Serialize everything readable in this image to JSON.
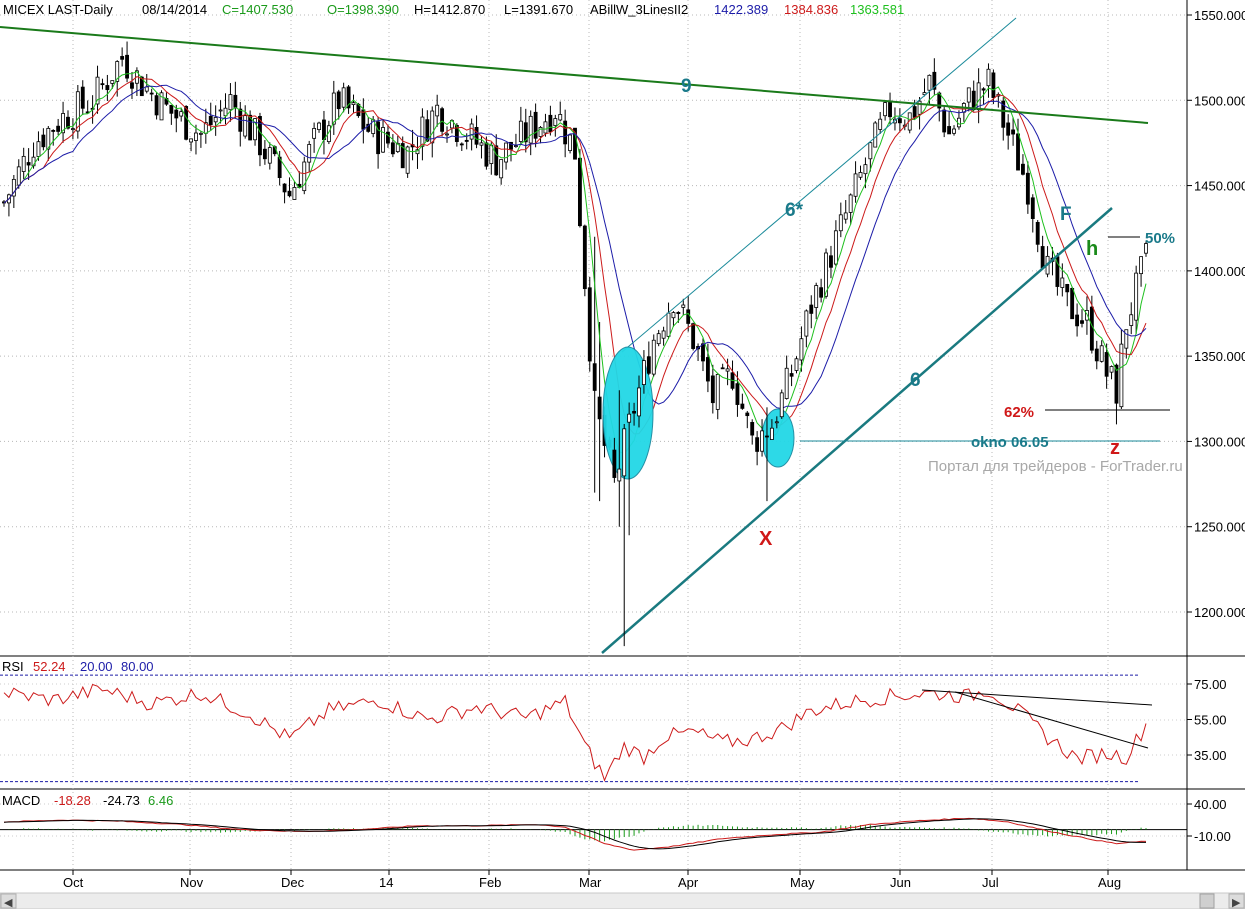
{
  "header": {
    "symbol": "MICEX LAST-Daily",
    "date": "08/14/2014",
    "close": "C=1407.530",
    "open": "O=1398.390",
    "high": "H=1412.870",
    "low": "L=1391.670",
    "indicator": "ABillW_3LinesII2",
    "ind_blue": "1422.389",
    "ind_red": "1384.836",
    "ind_green": "1363.581"
  },
  "watermark": "Портал для трейдеров - ForTrader.ru",
  "annotations": {
    "line9": "9",
    "line6star": "6*",
    "line6": "6",
    "X": "X",
    "F": "F",
    "h": "h",
    "z": "z",
    "pct50": "50%",
    "pct62": "62%",
    "okno": "okno 06.05"
  },
  "rsi": {
    "label": "RSI",
    "value": "52.24",
    "lower": "20.00",
    "upper": "80.00"
  },
  "macd": {
    "label": "MACD",
    "v1": "-18.28",
    "v2": "-24.73",
    "v3": "6.46"
  },
  "colors": {
    "up": "#000000",
    "down": "#000000",
    "ma_blue": "#1c1ca8",
    "ma_red": "#cc1a1a",
    "ma_green": "#1ec01e",
    "trend_green": "#1a7a1a",
    "channel": "#1a8a8a",
    "ellipse": "#22d8e6",
    "annot_red": "#d01818",
    "annot_teal": "#1a7a8a"
  },
  "chart_data": {
    "type": "candlestick",
    "price_axis": {
      "ticks": [
        "1550.000",
        "1500.000",
        "1450.000",
        "1400.000",
        "1350.000",
        "1300.000",
        "1250.000",
        "1200.000"
      ],
      "ylim": [
        1170,
        1560
      ]
    },
    "rsi_axis": {
      "ticks": [
        "75.00",
        "55.00",
        "35.00"
      ],
      "ylim": [
        15,
        95
      ]
    },
    "macd_axis": {
      "ticks": [
        "40.00",
        "-10.00"
      ],
      "ylim": [
        -40,
        55
      ]
    },
    "x_labels": [
      "Oct",
      "Nov",
      "Dec",
      "14",
      "Feb",
      "Mar",
      "Apr",
      "May",
      "Jun",
      "Jul",
      "Aug"
    ],
    "grid": true,
    "price_keyframes": [
      [
        0,
        1440
      ],
      [
        6,
        1475
      ],
      [
        12,
        1490
      ],
      [
        18,
        1500
      ],
      [
        24,
        1525
      ],
      [
        28,
        1510
      ],
      [
        33,
        1495
      ],
      [
        40,
        1480
      ],
      [
        46,
        1500
      ],
      [
        52,
        1475
      ],
      [
        58,
        1445
      ],
      [
        63,
        1475
      ],
      [
        68,
        1500
      ],
      [
        75,
        1480
      ],
      [
        82,
        1470
      ],
      [
        88,
        1495
      ],
      [
        94,
        1480
      ],
      [
        100,
        1465
      ],
      [
        106,
        1480
      ],
      [
        112,
        1495
      ],
      [
        116,
        1470
      ],
      [
        120,
        1320
      ],
      [
        124,
        1275
      ],
      [
        128,
        1320
      ],
      [
        132,
        1360
      ],
      [
        136,
        1385
      ],
      [
        140,
        1360
      ],
      [
        144,
        1325
      ],
      [
        148,
        1340
      ],
      [
        152,
        1300
      ],
      [
        156,
        1310
      ],
      [
        160,
        1340
      ],
      [
        164,
        1380
      ],
      [
        168,
        1410
      ],
      [
        172,
        1440
      ],
      [
        176,
        1470
      ],
      [
        180,
        1495
      ],
      [
        184,
        1490
      ],
      [
        188,
        1510
      ],
      [
        192,
        1480
      ],
      [
        196,
        1500
      ],
      [
        200,
        1510
      ],
      [
        204,
        1480
      ],
      [
        208,
        1450
      ],
      [
        212,
        1400
      ],
      [
        216,
        1380
      ],
      [
        220,
        1370
      ],
      [
        224,
        1340
      ],
      [
        226,
        1330
      ],
      [
        228,
        1370
      ],
      [
        232,
        1407
      ]
    ],
    "rsi_keyframes": [
      [
        0,
        70
      ],
      [
        10,
        66
      ],
      [
        20,
        72
      ],
      [
        30,
        64
      ],
      [
        40,
        70
      ],
      [
        50,
        58
      ],
      [
        58,
        44
      ],
      [
        66,
        60
      ],
      [
        76,
        66
      ],
      [
        86,
        55
      ],
      [
        96,
        62
      ],
      [
        106,
        56
      ],
      [
        114,
        65
      ],
      [
        118,
        40
      ],
      [
        122,
        22
      ],
      [
        126,
        40
      ],
      [
        130,
        34
      ],
      [
        134,
        45
      ],
      [
        140,
        48
      ],
      [
        146,
        42
      ],
      [
        152,
        44
      ],
      [
        158,
        50
      ],
      [
        164,
        60
      ],
      [
        172,
        65
      ],
      [
        180,
        68
      ],
      [
        188,
        70
      ],
      [
        196,
        68
      ],
      [
        200,
        72
      ],
      [
        206,
        60
      ],
      [
        212,
        45
      ],
      [
        218,
        33
      ],
      [
        224,
        36
      ],
      [
        228,
        34
      ],
      [
        232,
        52
      ]
    ],
    "macd_keyframes": [
      [
        0,
        12
      ],
      [
        12,
        15
      ],
      [
        24,
        13
      ],
      [
        36,
        8
      ],
      [
        48,
        0
      ],
      [
        60,
        -3
      ],
      [
        72,
        0
      ],
      [
        84,
        6
      ],
      [
        96,
        6
      ],
      [
        108,
        8
      ],
      [
        114,
        4
      ],
      [
        122,
        -22
      ],
      [
        128,
        -32
      ],
      [
        136,
        -26
      ],
      [
        146,
        -14
      ],
      [
        156,
        -8
      ],
      [
        166,
        -4
      ],
      [
        176,
        8
      ],
      [
        186,
        14
      ],
      [
        196,
        18
      ],
      [
        204,
        12
      ],
      [
        212,
        -2
      ],
      [
        220,
        -14
      ],
      [
        226,
        -22
      ],
      [
        232,
        -18
      ]
    ],
    "bars_count": 233
  }
}
